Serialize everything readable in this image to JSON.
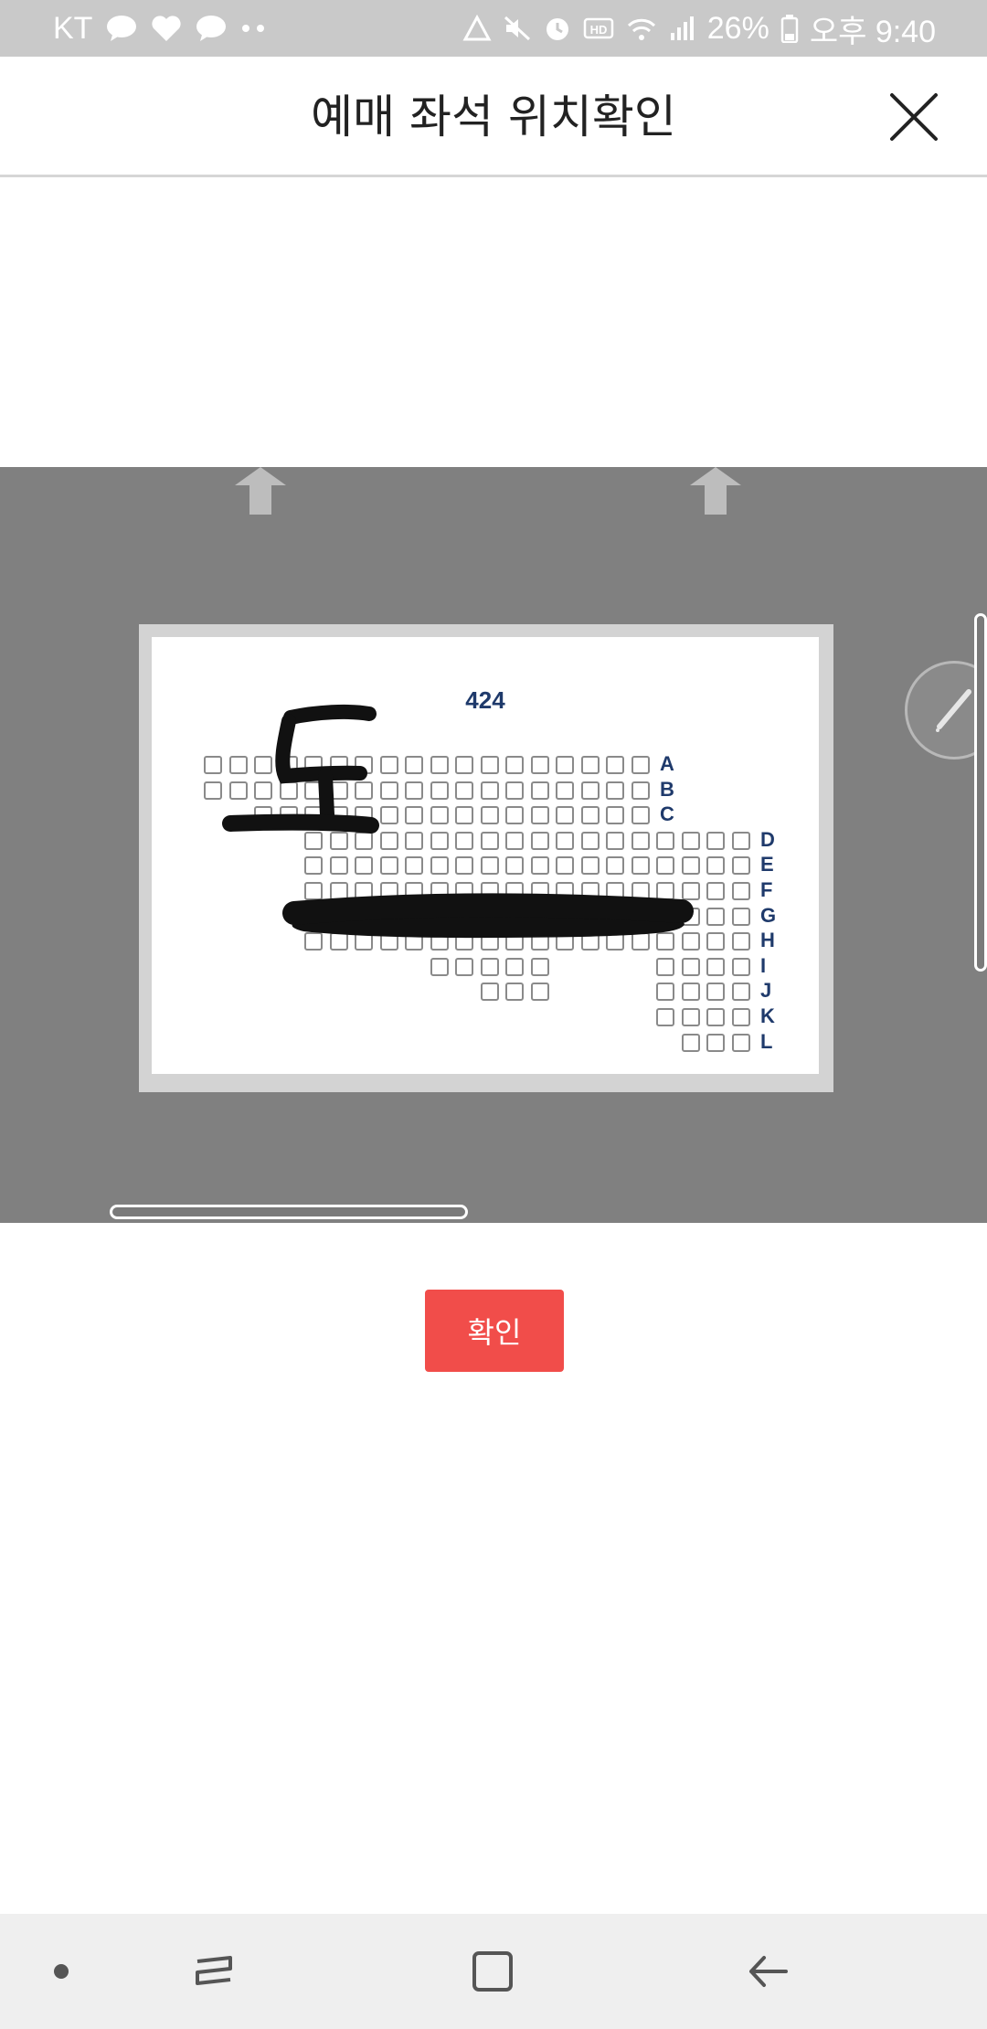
{
  "status_bar": {
    "carrier": "KT",
    "battery": "26%",
    "time": "오후 9:40"
  },
  "header": {
    "title": "예매 좌석 위치확인"
  },
  "seat_map": {
    "section_number": "424",
    "handwritten_mark": "토",
    "rows": [
      "A",
      "B",
      "C",
      "D",
      "E",
      "F",
      "G",
      "H",
      "I",
      "J",
      "K",
      "L"
    ]
  },
  "confirm_button": {
    "label": "확인"
  },
  "colors": {
    "accent": "#f14d4a",
    "map_background": "#808080",
    "row_label": "#1f3a6b"
  }
}
